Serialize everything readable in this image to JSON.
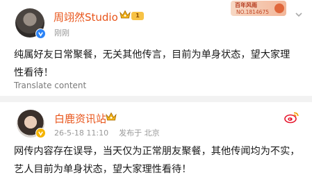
{
  "post1": {
    "author": "周翊然Studio",
    "level_badge": "1",
    "time": "刚刚",
    "text": "纯属好友日常聚餐，无关其他传言，目前为单身状态，望大家理性看待！",
    "translate_label": "Translate content",
    "card": {
      "title": "百年风雨",
      "number": "NO.1814675"
    },
    "icons": {
      "avatar": "avatar",
      "verified": "blue-v-verified-icon",
      "crown": "crown-icon",
      "card": "fan-card",
      "more": "close-icon"
    }
  },
  "post2": {
    "author": "白鹿资讯站",
    "time": "26-5-18 11:10",
    "location": "发布于 北京",
    "text": "网传内容存在误导，当天仅为正常朋友聚餐，其他传闻均为不实，艺人目前为单身状态，望大家理性看待！",
    "icons": {
      "avatar": "avatar",
      "verified": "yellow-v-verified-icon",
      "crown": "crown-icon",
      "more": "weibo-icon"
    }
  },
  "colors": {
    "name": "#e8541a",
    "meta": "#999999",
    "verified_blue": "#2b83f6",
    "verified_yellow": "#f5b400"
  }
}
